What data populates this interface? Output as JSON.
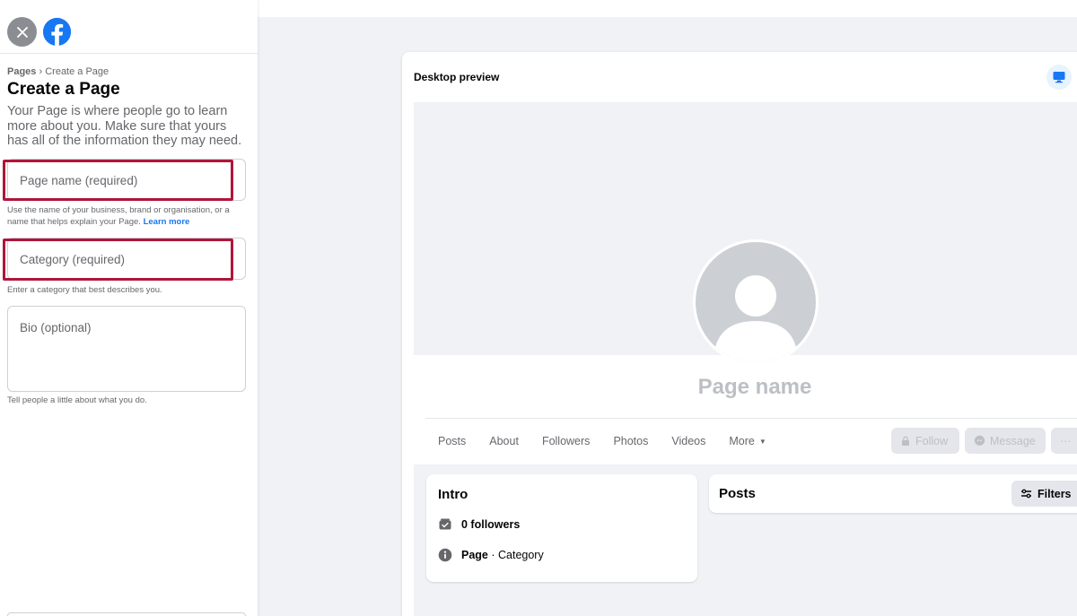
{
  "sidebar": {
    "breadcrumb": {
      "root": "Pages",
      "separator": "›",
      "current": "Create a Page"
    },
    "title": "Create a Page",
    "description": "Your Page is where people go to learn more about you. Make sure that yours has all of the information they may need.",
    "fields": {
      "page_name": {
        "placeholder": "Page name (required)",
        "helper": "Use the name of your business, brand or organisation, or a name that helps explain your Page.",
        "helper_link": "Learn more"
      },
      "category": {
        "placeholder": "Category (required)",
        "helper": "Enter a category that best describes you."
      },
      "bio": {
        "placeholder": "Bio (optional)",
        "helper": "Tell people a little about what you do."
      }
    }
  },
  "preview": {
    "label": "Desktop preview",
    "page_name": "Page name",
    "tabs": [
      "Posts",
      "About",
      "Followers",
      "Photos",
      "Videos",
      "More"
    ],
    "buttons": {
      "follow": "Follow",
      "message": "Message",
      "more": "···"
    },
    "intro": {
      "title": "Intro",
      "followers": "0 followers",
      "page_type_bold": "Page",
      "page_type_rest": " · Category"
    },
    "posts": {
      "title": "Posts",
      "filters": "Filters"
    }
  },
  "colors": {
    "brand": "#1877f2",
    "highlight": "#b0153a"
  },
  "icons": [
    "close-icon",
    "facebook-logo-icon",
    "monitor-icon",
    "lock-icon",
    "messenger-icon",
    "followers-icon",
    "info-icon",
    "filters-icon",
    "caret-down-icon"
  ]
}
